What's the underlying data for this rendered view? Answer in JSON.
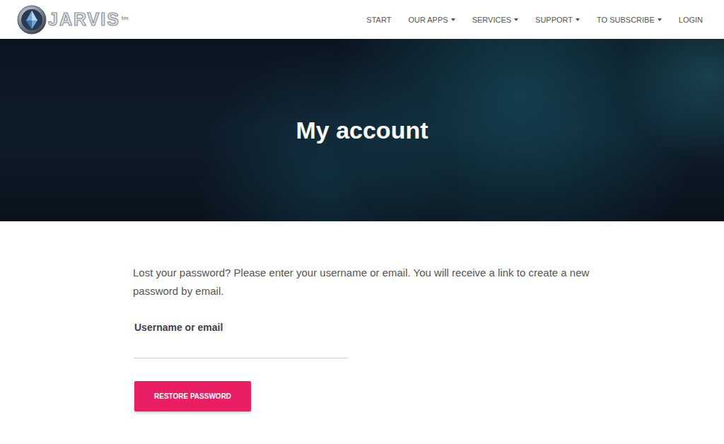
{
  "logo": {
    "text": "JARVIS",
    "superscript": "tm"
  },
  "nav": [
    {
      "label": "START",
      "dropdown": false
    },
    {
      "label": "OUR APPS",
      "dropdown": true
    },
    {
      "label": "SERVICES",
      "dropdown": true
    },
    {
      "label": "SUPPORT",
      "dropdown": true
    },
    {
      "label": "TO SUBSCRIBE",
      "dropdown": true
    },
    {
      "label": "LOGIN",
      "dropdown": false
    }
  ],
  "hero": {
    "title": "My account"
  },
  "form": {
    "instructions": "Lost your password? Please enter your username or email. You will receive a link to create a new password by email.",
    "field_label": "Username or email",
    "field_value": "",
    "button": "RESTORE PASSWORD"
  }
}
